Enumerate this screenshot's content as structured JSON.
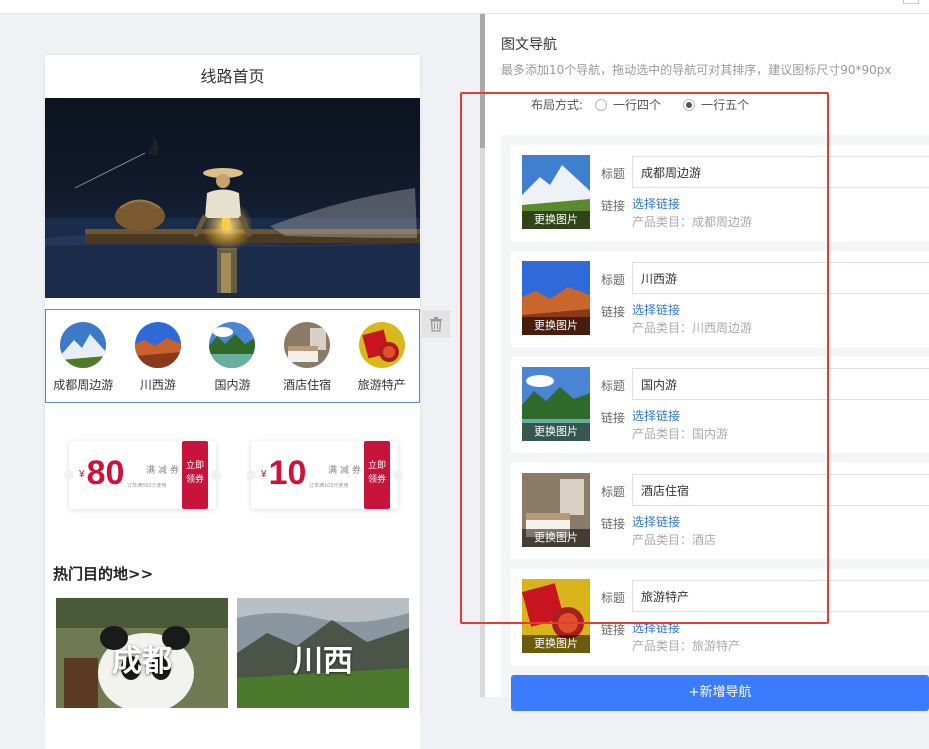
{
  "phone": {
    "title": "线路首页",
    "nav_items": [
      {
        "label": "成都周边游"
      },
      {
        "label": "川西游"
      },
      {
        "label": "国内游"
      },
      {
        "label": "酒店住宿"
      },
      {
        "label": "旅游特产"
      }
    ],
    "coupons": [
      {
        "currency": "¥",
        "amount": "80",
        "type": "满减券",
        "condition": "订单满500元使用",
        "action": "立即领券"
      },
      {
        "currency": "¥",
        "amount": "10",
        "type": "满减券",
        "condition": "订单满100元使用",
        "action": "立即领券"
      }
    ],
    "hot_title": "热门目的地>>",
    "hot_cards": [
      {
        "city": "成都"
      },
      {
        "city": "川西"
      }
    ]
  },
  "panel": {
    "title": "图文导航",
    "hint": "最多添加10个导航，拖动选中的导航可对其排序，建议图标尺寸90*90px",
    "layout_label": "布局方式:",
    "layout_options": [
      "一行四个",
      "一行五个"
    ],
    "layout_selected": "一行五个",
    "title_label": "标题",
    "link_label": "链接",
    "replace_label": "更换图片",
    "choose_link": "选择链接",
    "items": [
      {
        "title": "成都周边游",
        "category": "产品类目：成都周边游"
      },
      {
        "title": "川西游",
        "category": "产品类目：川西周边游"
      },
      {
        "title": "国内游",
        "category": "产品类目：国内游"
      },
      {
        "title": "酒店住宿",
        "category": "产品类目：酒店"
      },
      {
        "title": "旅游特产",
        "category": "产品类目：旅游特产"
      }
    ],
    "add_button": "+新增导航"
  },
  "colors": {
    "accent": "#3b7cff",
    "link": "#3377dd",
    "highlight": "#e53935",
    "coupon_red": "#c8143c"
  },
  "icons": [
    "trash-icon"
  ]
}
